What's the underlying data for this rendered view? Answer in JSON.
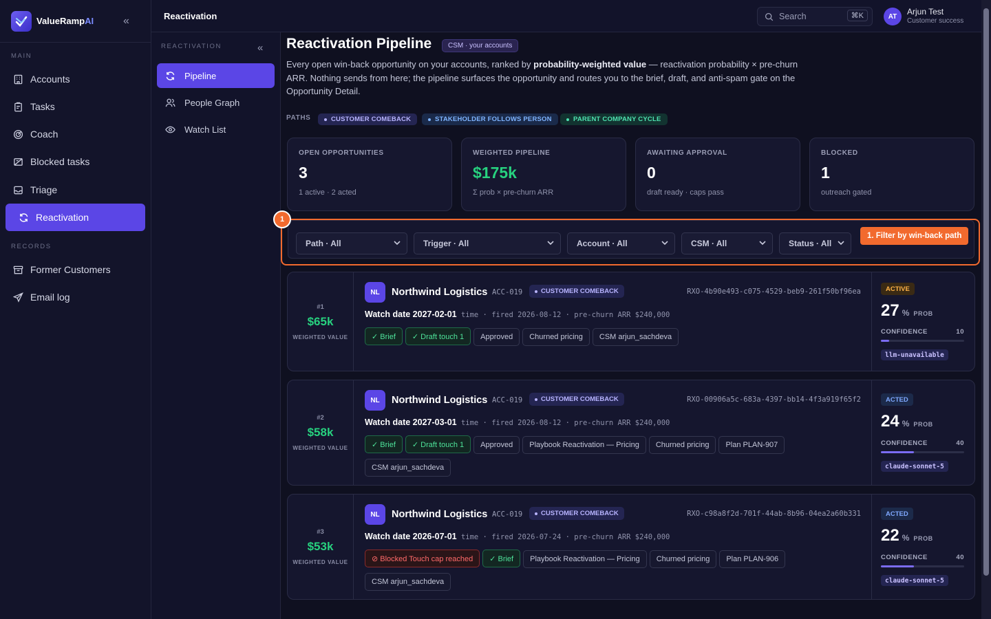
{
  "app": {
    "brand_prefix": "ValueRamp",
    "brand_suffix": "AI"
  },
  "sidebar": {
    "main_label": "MAIN",
    "records_label": "RECORDS",
    "items": [
      {
        "label": "Accounts",
        "icon": "building-icon"
      },
      {
        "label": "Tasks",
        "icon": "clipboard-icon"
      },
      {
        "label": "Coach",
        "icon": "target-icon"
      },
      {
        "label": "Blocked tasks",
        "icon": "blocked-tasks-icon"
      },
      {
        "label": "Triage",
        "icon": "inbox-icon"
      },
      {
        "label": "Reactivation",
        "icon": "refresh-icon",
        "active": true
      }
    ],
    "records": [
      {
        "label": "Former Customers",
        "icon": "archive-icon"
      },
      {
        "label": "Email log",
        "icon": "send-icon"
      }
    ]
  },
  "subnav": {
    "title": "Reactivation",
    "section": "REACTIVATION",
    "items": [
      {
        "label": "Pipeline",
        "active": true
      },
      {
        "label": "People Graph"
      },
      {
        "label": "Watch List"
      }
    ]
  },
  "header": {
    "search_label": "Search",
    "kbd": "⌘K",
    "user_initials": "AT",
    "user_name": "Arjun Test",
    "user_role": "Customer success"
  },
  "page": {
    "title": "Reactivation Pipeline",
    "badge": "CSM · your accounts",
    "desc_1": "Every open win-back opportunity on your accounts, ranked by ",
    "desc_bold": "probability-weighted value",
    "desc_2": " — reactivation probability × pre-churn ARR. Nothing sends from here; the pipeline surfaces the opportunity and routes you to the brief, draft, and anti-spam gate on the Opportunity Detail.",
    "paths_label": "PATHS",
    "paths": [
      "CUSTOMER COMEBACK",
      "STAKEHOLDER FOLLOWS PERSON",
      "PARENT COMPANY CYCLE"
    ],
    "colors": {
      "comeback": "#b8b4ff",
      "stakeholder": "#7fb4ff",
      "parent": "#4ee3b0",
      "accent": "#5b46e6",
      "orange": "#f26a2e",
      "green": "#27d17f"
    }
  },
  "stats": [
    {
      "label": "OPEN OPPORTUNITIES",
      "value": "3",
      "sub": "1 active · 2 acted"
    },
    {
      "label": "WEIGHTED PIPELINE",
      "value": "$175k",
      "sub": "Σ prob × pre-churn ARR"
    },
    {
      "label": "AWAITING APPROVAL",
      "value": "0",
      "sub": "draft ready · caps pass"
    },
    {
      "label": "BLOCKED",
      "value": "1",
      "sub": "outreach gated"
    }
  ],
  "filters": {
    "path": "Path · All",
    "trigger": "Trigger · All",
    "account": "Account · All",
    "csm": "CSM · All",
    "status": "Status · All",
    "hint": "1. Filter by win-back path",
    "marker": "1"
  },
  "opps": [
    {
      "rank": "#1",
      "weighted": "$65k",
      "weighted_label": "WEIGHTED VALUE",
      "initials": "NL",
      "name": "Northwind Logistics",
      "acc": "ACC-019",
      "path": "CUSTOMER COMEBACK",
      "rxo": "RXO-4b90e493-c075-4529-beb9-261f50bf96ea",
      "watch": "Watch date 2027-02-01",
      "meta": " time · fired 2026-08-12 · pre-churn ARR $240,000",
      "chips": [
        "✓ Brief",
        "✓ Draft touch 1",
        "Approved",
        "Churned pricing",
        "CSM arjun_sachdeva"
      ],
      "status": "ACTIVE",
      "prob": "27",
      "prob_unit": "%",
      "prob_label": "PROB",
      "conf_label": "CONFIDENCE",
      "conf": "10",
      "conf_level": 0.1,
      "model": "llm-unavailable"
    },
    {
      "rank": "#2",
      "weighted": "$58k",
      "weighted_label": "WEIGHTED VALUE",
      "initials": "NL",
      "name": "Northwind Logistics",
      "acc": "ACC-019",
      "path": "CUSTOMER COMEBACK",
      "rxo": "RXO-00906a5c-683a-4397-bb14-4f3a919f65f2",
      "watch": "Watch date 2027-03-01",
      "meta": " time · fired 2026-08-12 · pre-churn ARR $240,000",
      "chips": [
        "✓ Brief",
        "✓ Draft touch 1",
        "Approved",
        "Playbook Reactivation — Pricing",
        "Churned pricing",
        "Plan PLAN-907",
        "CSM arjun_sachdeva"
      ],
      "status": "ACTED",
      "prob": "24",
      "prob_unit": "%",
      "prob_label": "PROB",
      "conf_label": "CONFIDENCE",
      "conf": "40",
      "conf_level": 0.4,
      "model": "claude-sonnet-5"
    },
    {
      "rank": "#3",
      "weighted": "$53k",
      "weighted_label": "WEIGHTED VALUE",
      "initials": "NL",
      "name": "Northwind Logistics",
      "acc": "ACC-019",
      "path": "CUSTOMER COMEBACK",
      "rxo": "RXO-c98a8f2d-701f-44ab-8b96-04ea2a60b331",
      "watch": "Watch date 2026-07-01",
      "meta": " time · fired 2026-07-24 · pre-churn ARR $240,000",
      "chips": [
        "⊘ Blocked Touch cap reached",
        "✓ Brief",
        "Playbook Reactivation — Pricing",
        "Churned pricing",
        "Plan PLAN-906",
        "CSM arjun_sachdeva"
      ],
      "status": "ACTED",
      "prob": "22",
      "prob_unit": "%",
      "prob_label": "PROB",
      "conf_label": "CONFIDENCE",
      "conf": "40",
      "conf_level": 0.4,
      "model": "claude-sonnet-5"
    }
  ]
}
